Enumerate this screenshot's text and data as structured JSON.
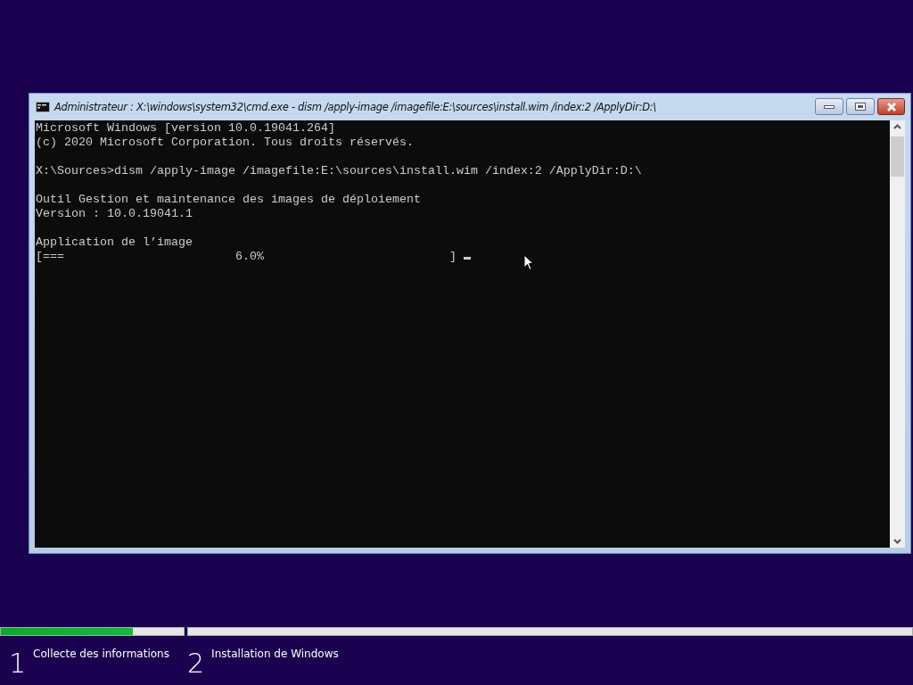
{
  "window": {
    "title": "Administrateur : X:\\windows\\system32\\cmd.exe - dism  /apply-image /imagefile:E:\\sources\\install.wim /index:2 /ApplyDir:D:\\"
  },
  "console": {
    "blocks": [
      [
        "Microsoft Windows [version 10.0.19041.264]",
        "(c) 2020 Microsoft Corporation. Tous droits réservés."
      ],
      [
        "X:\\Sources>dism /apply-image /imagefile:E:\\sources\\install.wim /index:2 /ApplyDir:D:\\"
      ],
      [
        "Outil Gestion et maintenance des images de déploiement",
        "Version : 10.0.19041.1"
      ],
      [
        "Application de l’image",
        "[===                        6.0%                          ]"
      ]
    ]
  },
  "steps": [
    {
      "number": "1",
      "label": "Collecte des informations",
      "level": 0.72
    },
    {
      "number": "2",
      "label": "Installation de Windows"
    }
  ]
}
